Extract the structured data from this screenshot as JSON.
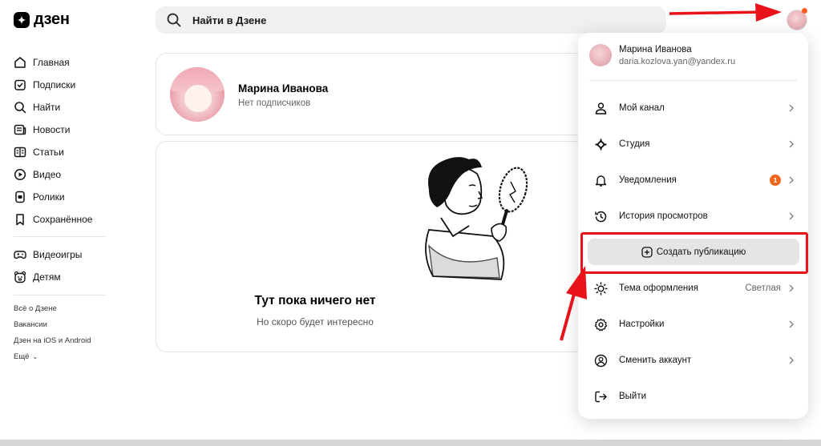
{
  "logo": {
    "text": "дзен"
  },
  "search": {
    "placeholder": "Найти в Дзене"
  },
  "sidebar": {
    "items": [
      {
        "label": "Главная",
        "icon": "home-icon"
      },
      {
        "label": "Подписки",
        "icon": "subscriptions-icon"
      },
      {
        "label": "Найти",
        "icon": "search-icon"
      },
      {
        "label": "Новости",
        "icon": "news-icon"
      },
      {
        "label": "Статьи",
        "icon": "articles-icon"
      },
      {
        "label": "Видео",
        "icon": "video-icon"
      },
      {
        "label": "Ролики",
        "icon": "clips-icon"
      },
      {
        "label": "Сохранённое",
        "icon": "bookmark-icon"
      }
    ],
    "items2": [
      {
        "label": "Видеоигры",
        "icon": "gamepad-icon"
      },
      {
        "label": "Детям",
        "icon": "kids-icon"
      }
    ],
    "footer": [
      {
        "label": "Всё о Дзене"
      },
      {
        "label": "Вакансии"
      },
      {
        "label": "Дзен на iOS и Android"
      },
      {
        "label": "Ещё"
      }
    ]
  },
  "profile": {
    "name": "Марина Иванова",
    "subscribers": "Нет подписчиков"
  },
  "empty_state": {
    "title": "Тут пока ничего нет",
    "subtitle": "Но скоро будет интересно"
  },
  "menu": {
    "user_name": "Марина Иванова",
    "user_email": "daria.kozlova.yan@yandex.ru",
    "items": [
      {
        "label": "Мой канал",
        "icon": "person-icon"
      },
      {
        "label": "Студия",
        "icon": "studio-icon"
      },
      {
        "label": "Уведомления",
        "icon": "bell-icon",
        "badge": "1"
      },
      {
        "label": "История просмотров",
        "icon": "history-icon"
      }
    ],
    "create_label": "Создать публикацию",
    "items_after": [
      {
        "label": "Тема оформления",
        "icon": "sun-icon",
        "value": "Светлая"
      },
      {
        "label": "Настройки",
        "icon": "gear-icon"
      },
      {
        "label": "Сменить аккаунт",
        "icon": "switch-account-icon"
      },
      {
        "label": "Выйти",
        "icon": "logout-icon"
      }
    ]
  },
  "colors": {
    "accent_red": "#e8121b",
    "badge_orange": "#f0661d",
    "search_bg": "#eef0f1"
  }
}
